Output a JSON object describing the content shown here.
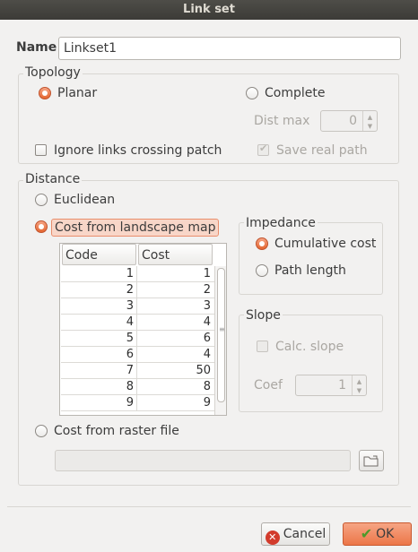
{
  "window": {
    "title": "Link set"
  },
  "name": {
    "label": "Name",
    "value": "Linkset1"
  },
  "topology": {
    "title": "Topology",
    "planar_label": "Planar",
    "complete_label": "Complete",
    "dist_max_label": "Dist max",
    "dist_max_value": "0",
    "ignore_links_label": "Ignore links crossing patch",
    "save_real_path_label": "Save real path"
  },
  "distance": {
    "title": "Distance",
    "euclidean_label": "Euclidean",
    "cost_landscape_label": "Cost from landscape map",
    "cost_raster_label": "Cost from raster file",
    "table": {
      "headers": [
        "Code",
        "Cost"
      ],
      "rows": [
        [
          "1",
          "1"
        ],
        [
          "2",
          "2"
        ],
        [
          "3",
          "3"
        ],
        [
          "4",
          "4"
        ],
        [
          "5",
          "6"
        ],
        [
          "6",
          "4"
        ],
        [
          "7",
          "50"
        ],
        [
          "8",
          "8"
        ],
        [
          "9",
          "9"
        ]
      ]
    },
    "impedance": {
      "title": "Impedance",
      "cumulative_label": "Cumulative cost",
      "path_length_label": "Path length"
    },
    "slope": {
      "title": "Slope",
      "calc_slope_label": "Calc. slope",
      "coef_label": "Coef",
      "coef_value": "1"
    },
    "raster_path": ""
  },
  "buttons": {
    "cancel_label": "Cancel",
    "ok_label": "OK"
  }
}
